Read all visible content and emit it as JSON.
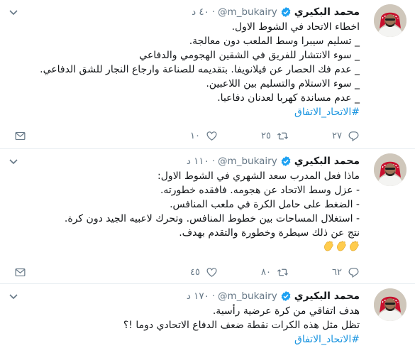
{
  "tweets": [
    {
      "name": "محمد البكيري",
      "handle": "@m_bukairy",
      "time": "٤٠ د",
      "lines": [
        "اخطاء الاتحاد في الشوط الاول.",
        "_ تسليم سيبرا وسط الملعب دون معالجة.",
        "_ سوء الانتشار للفريق في الشقين الهجومي والدفاعي",
        "_ عدم فك الحصار عن فيلانويفا. بتقديمه للصناعة وارجاع  النجار للشق الدفاعي.",
        "_ سوء الاستلام والتسليم بين اللاعبين.",
        "_ عدم مساندة كهربا لعدنان دفاعيا."
      ],
      "hashtags": "#الاتحاد_الاتفاق",
      "replies": "٢٧",
      "retweets": "٢٥",
      "likes": "١٠"
    },
    {
      "name": "محمد البكيري",
      "handle": "@m_bukairy",
      "time": "١١٠ د",
      "lines": [
        "ماذا فعل المدرب سعد الشهري في الشوط الاول:",
        "- عزل وسط الاتحاد عن هجومه. فافقده خطورته.",
        "- الضغط على حامل الكرة في ملعب المنافس.",
        "- استغلال المساحات بين خطوط المنافس. وتحرك لاعبيه الجيد دون كرة.",
        "نتج عن ذلك سيطرة وخطورة والتقدم بهدف."
      ],
      "emoji": "clapping-hands",
      "replies": "٦٢",
      "retweets": "٨٠",
      "likes": "٤٥"
    },
    {
      "name": "محمد البكيري",
      "handle": "@m_bukairy",
      "time": "١٧٠ د",
      "lines": [
        "هدف اتفاقي من كرة عرضية رأسية.",
        "تظل مثل هذه الكرات نقطة ضعف الدفاع الاتحادي دوما !؟"
      ],
      "hashtags": "#الاتحاد_الاتفاق"
    }
  ],
  "colors": {
    "link": "#1b95e0",
    "muted": "#657786",
    "verified": "#1da1f2",
    "divider": "#e6ecf0"
  }
}
